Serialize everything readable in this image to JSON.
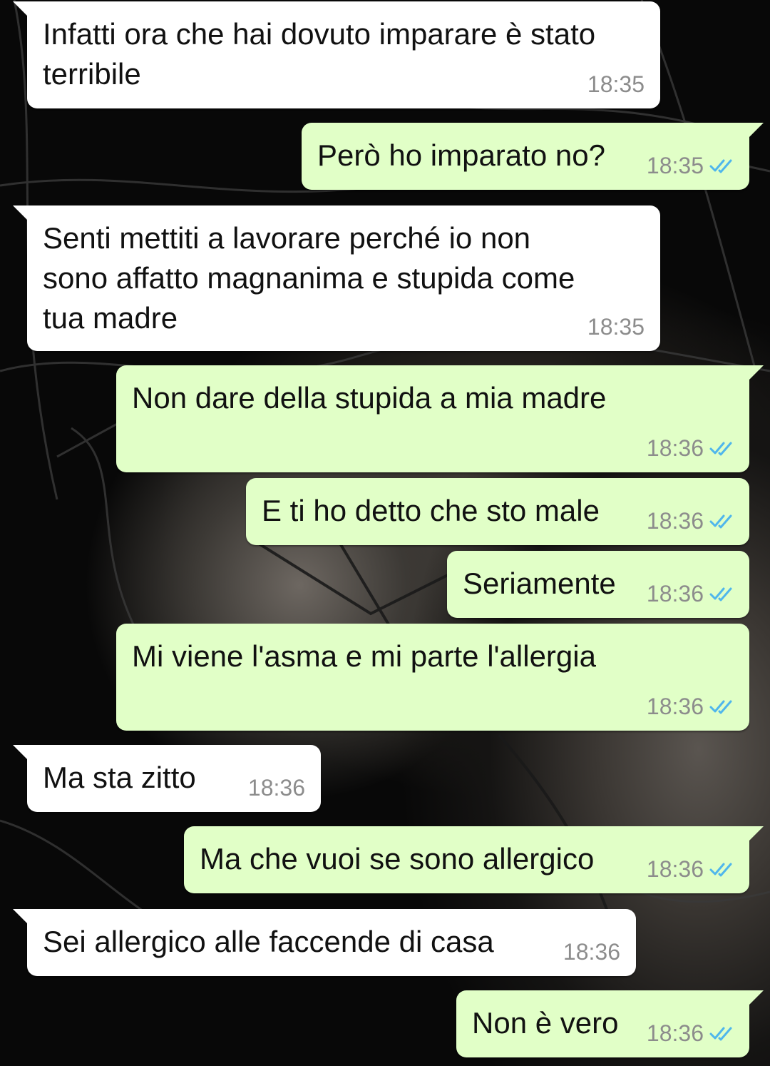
{
  "colors": {
    "incoming_bubble": "#ffffff",
    "outgoing_bubble": "#e1ffc7",
    "timestamp": "#8c8c8c",
    "read_ticks": "#4fb6ec"
  },
  "messages": [
    {
      "direction": "in",
      "text": "Infatti ora che hai dovuto imparare è stato\nterribile",
      "time": "18:35"
    },
    {
      "direction": "out",
      "text": "Però ho imparato no?",
      "time": "18:35",
      "status_icon": "double-check-read-icon"
    },
    {
      "direction": "in",
      "text": "Senti mettiti a lavorare perché io non\nsono affatto magnanima e stupida come\ntua madre",
      "time": "18:35"
    },
    {
      "direction": "out",
      "text": "Non dare della stupida a mia madre",
      "time": "18:36",
      "status_icon": "double-check-read-icon"
    },
    {
      "direction": "out",
      "text": "E ti ho detto che sto male",
      "time": "18:36",
      "status_icon": "double-check-read-icon"
    },
    {
      "direction": "out",
      "text": "Seriamente",
      "time": "18:36",
      "status_icon": "double-check-read-icon"
    },
    {
      "direction": "out",
      "text": "Mi viene l'asma e mi parte l'allergia",
      "time": "18:36",
      "status_icon": "double-check-read-icon"
    },
    {
      "direction": "in",
      "text": "Ma sta zitto",
      "time": "18:36"
    },
    {
      "direction": "out",
      "text": "Ma che vuoi se sono allergico",
      "time": "18:36",
      "status_icon": "double-check-read-icon"
    },
    {
      "direction": "in",
      "text": "Sei allergico alle faccende di casa",
      "time": "18:36"
    },
    {
      "direction": "out",
      "text": "Non è vero",
      "time": "18:36",
      "status_icon": "double-check-read-icon"
    }
  ]
}
